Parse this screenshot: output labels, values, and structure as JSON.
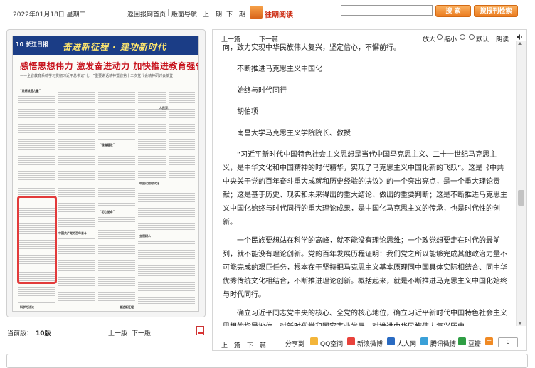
{
  "topbar": {
    "date": "2022年01月18日 星期二",
    "links": [
      "返回报网首页",
      "版面导航",
      "上一期",
      "下一期"
    ],
    "history_label": "往期阅读",
    "search_placeholder": "",
    "search_button": "搜 索",
    "site_search_button": "搜报刊检索"
  },
  "newspaper": {
    "page_badge": "10 长江日报",
    "banner": "奋进新征程 · 建功新时代",
    "headline": "感悟思想伟力 激发奋进动力 加快推进教育强省建设",
    "subline": "——全省教育系统学习贯彻习近平总书记“七一”重要讲话精神暨省第十二次党代会精神研讨会摘登",
    "block_heads": [
      "“思想就是力量”",
      "“强省建设”",
      "人民至上",
      "中国共产党的百年奋斗",
      "“初心使命”",
      "中国化的时代化",
      "立德树人",
      "科学方法论",
      "奋进新征程"
    ],
    "current_page_label": "当前版：",
    "current_page_value": "10版",
    "prev_page": "上一版",
    "next_page": "下一版"
  },
  "article": {
    "nav_prev": "上一篇",
    "nav_next": "下一篇",
    "zoom_label": "放大",
    "zoom_small": "缩小",
    "zoom_default": "默认",
    "read_aloud": "朗读",
    "paragraphs": [
      "向，致力实现中华民族伟大复兴，坚定信心，不懈前行。",
      "不断推进马克思主义中国化",
      "始终与时代同行",
      "胡伯项",
      "南昌大学马克思主义学院院长、教授",
      "“习近平新时代中国特色社会主义思想是当代中国马克思主义、二十一世纪马克思主义，是中华文化和中国精神的时代精华，实现了马克思主义中国化新的飞跃”。这是《中共中央关于党的百年奋斗重大成就和历史经验的决议》的一个突出亮点，是一个重大理论贡献；这是基于历史、现实和未来得出的重大结论、做出的重要判断；这是不断推进马克思主义中国化始终与时代同行的重大理论成果，是中国化马克思主义的传承，也是时代性的创新。",
      "一个民族要想站在科学的高峰，就不能没有理论思维；一个政党想要走在时代的最前列，就不能没有理论创新。党的百年发展历程证明：我们党之所以能够完成其他政治力量不可能完成的艰巨任务，根本在于坚持把马克思主义基本原理同中国具体实际相结合、同中华优秀传统文化相结合，不断推进理论创新。概括起来，就是不断推进马克思主义中国化始终与时代同行。",
      "确立习近平同志党中央的核心、全党的核心地位，确立习近平新时代中国特色社会主义思想的指导地位，对新时代党和国家事业发展、对推进中华民族伟大复兴历史"
    ],
    "bottom_prev": "上一篇",
    "bottom_next": "下一篇",
    "share_label": "分享到",
    "share_items": [
      "QQ空间",
      "新浪微博",
      "人人网",
      "腾讯微博",
      "豆瓣"
    ],
    "share_count": "0"
  },
  "colors": {
    "banner_blue": "#1b3d86",
    "headline_red": "#c8141e",
    "accent_orange": "#ea7b1f",
    "selection_red": "#e23b3b"
  }
}
